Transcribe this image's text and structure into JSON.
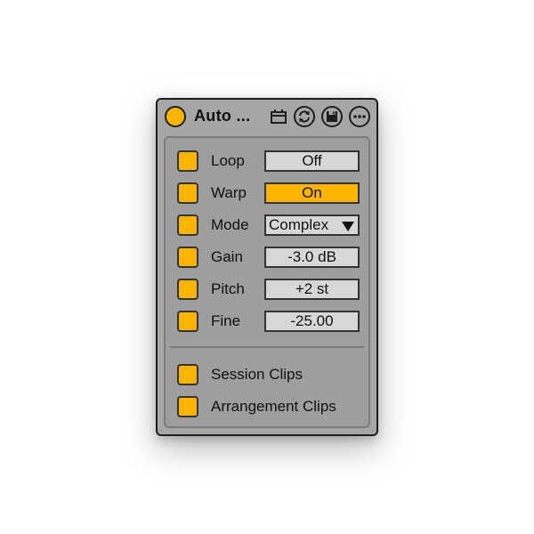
{
  "device": {
    "title": "Auto ...",
    "header_icons": [
      "clip-icon",
      "sync-icon",
      "save-icon",
      "more-icon"
    ]
  },
  "params": [
    {
      "label": "Loop",
      "value": "Off"
    },
    {
      "label": "Warp",
      "value": "On"
    },
    {
      "label": "Mode",
      "value": "Complex"
    },
    {
      "label": "Gain",
      "value": "-3.0 dB"
    },
    {
      "label": "Pitch",
      "value": "+2 st"
    },
    {
      "label": "Fine",
      "value": "-25.00"
    }
  ],
  "targets": [
    {
      "label": "Session Clips"
    },
    {
      "label": "Arrangement Clips"
    }
  ],
  "colors": {
    "accent": "#ffb400",
    "device_bg": "#a6a6a6",
    "panel_bg": "#9e9e9e",
    "field_bg": "#d7d7d7",
    "outline": "#1e1e1e"
  }
}
